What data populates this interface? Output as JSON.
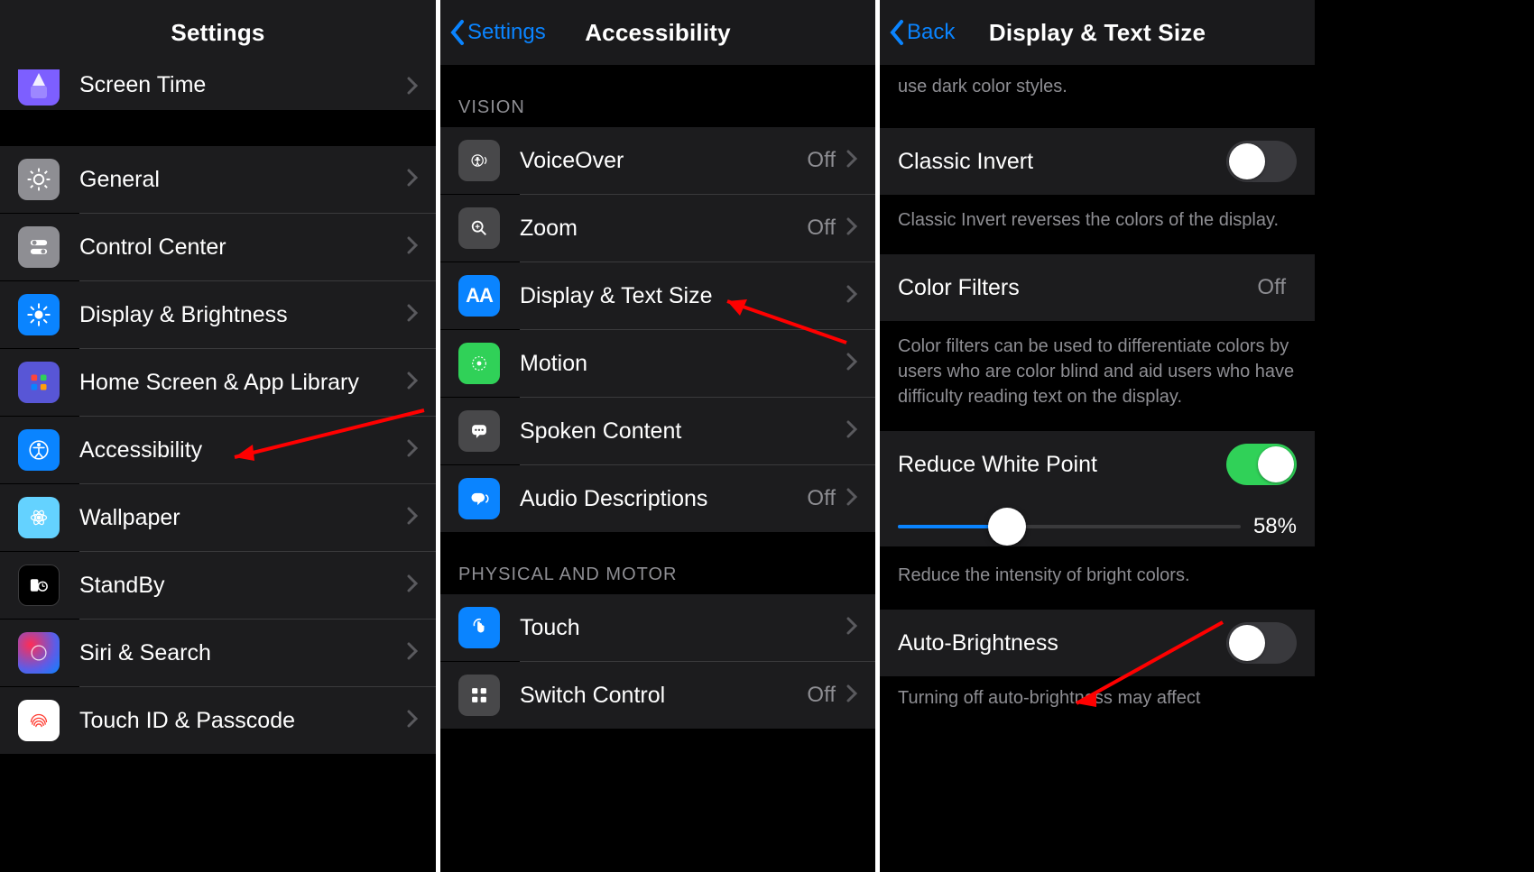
{
  "pane1": {
    "title": "Settings",
    "rows": [
      {
        "label": "Screen Time"
      },
      {
        "label": "General"
      },
      {
        "label": "Control Center"
      },
      {
        "label": "Display & Brightness"
      },
      {
        "label": "Home Screen & App Library"
      },
      {
        "label": "Accessibility"
      },
      {
        "label": "Wallpaper"
      },
      {
        "label": "StandBy"
      },
      {
        "label": "Siri & Search"
      },
      {
        "label": "Touch ID & Passcode"
      }
    ]
  },
  "pane2": {
    "back": "Settings",
    "title": "Accessibility",
    "section_vision": "VISION",
    "section_physical": "PHYSICAL AND MOTOR",
    "vision_rows": [
      {
        "label": "VoiceOver",
        "value": "Off"
      },
      {
        "label": "Zoom",
        "value": "Off"
      },
      {
        "label": "Display & Text Size",
        "value": ""
      },
      {
        "label": "Motion",
        "value": ""
      },
      {
        "label": "Spoken Content",
        "value": ""
      },
      {
        "label": "Audio Descriptions",
        "value": "Off"
      }
    ],
    "physical_rows": [
      {
        "label": "Touch",
        "value": ""
      },
      {
        "label": "Switch Control",
        "value": "Off"
      }
    ]
  },
  "pane3": {
    "back": "Back",
    "title": "Display & Text Size",
    "dark_tail": "use dark color styles.",
    "classic_invert_label": "Classic Invert",
    "classic_invert_on": false,
    "classic_invert_footer": "Classic Invert reverses the colors of the display.",
    "color_filters_label": "Color Filters",
    "color_filters_value": "Off",
    "color_filters_footer": "Color filters can be used to differentiate colors by users who are color blind and aid users who have difficulty reading text on the display.",
    "reduce_white_label": "Reduce White Point",
    "reduce_white_on": true,
    "reduce_white_percent": 58,
    "reduce_white_percent_label": "58%",
    "reduce_white_footer": "Reduce the intensity of bright colors.",
    "auto_brightness_label": "Auto-Brightness",
    "auto_brightness_on": false,
    "auto_brightness_tail": "Turning off auto-brightness may affect"
  }
}
